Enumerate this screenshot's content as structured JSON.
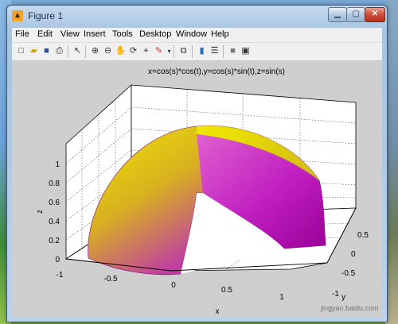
{
  "window": {
    "title": "Figure 1",
    "app_icon": "matlab-logo"
  },
  "menubar": {
    "items": [
      {
        "label": "File"
      },
      {
        "label": "Edit"
      },
      {
        "label": "View"
      },
      {
        "label": "Insert"
      },
      {
        "label": "Tools"
      },
      {
        "label": "Desktop"
      },
      {
        "label": "Window"
      },
      {
        "label": "Help"
      }
    ]
  },
  "toolbar": {
    "buttons": [
      "new-figure-icon",
      "open-file-icon",
      "save-icon",
      "print-icon",
      "select-arrow-icon",
      "zoom-in-icon",
      "zoom-out-icon",
      "pan-hand-icon",
      "rotate-3d-icon",
      "data-cursor-icon",
      "brush-icon",
      "link-plot-icon",
      "colorbar-icon",
      "legend-icon",
      "hide-plot-tools-icon",
      "show-plot-tools-icon"
    ]
  },
  "plot": {
    "title": "x=cos(s)*cos(t),y=cos(s)*sin(t),z=sin(s)",
    "xlabel": "x",
    "ylabel": "y",
    "zlabel": "z",
    "xticks": [
      "-1",
      "-0.5",
      "0",
      "0.5",
      "1"
    ],
    "yticks": [
      "-1",
      "-0.5",
      "0",
      "0.5"
    ],
    "zticks": [
      "0",
      "0.2",
      "0.4",
      "0.6",
      "0.8",
      "1"
    ],
    "colors": {
      "yellow": "#e6e400",
      "magenta": "#b000b0",
      "orange": "#e58f1a"
    }
  },
  "watermark": "jingyan.baidu.com"
}
